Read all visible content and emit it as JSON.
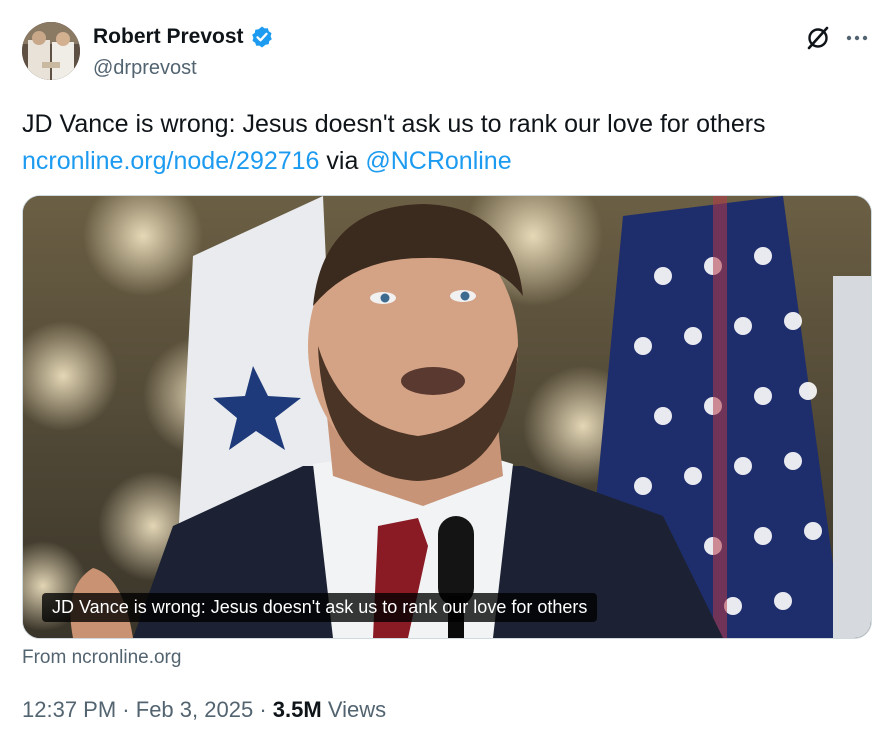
{
  "author": {
    "name": "Robert Prevost",
    "handle": "@drprevost",
    "verified_color": "#1d9bf0"
  },
  "tweet": {
    "text_line": "JD Vance is wrong: Jesus doesn't ask us to rank our love for others",
    "link_text": "ncronline.org/node/292716",
    "via_text": "via",
    "mention_text": "@NCRonline"
  },
  "card": {
    "caption": "JD Vance is wrong: Jesus doesn't ask us to rank our love for others",
    "source": "From ncronline.org"
  },
  "meta": {
    "time": "12:37 PM",
    "dot1": "·",
    "date": "Feb 3, 2025",
    "dot2": "·",
    "views_count": "3.5M",
    "views_label": "Views"
  },
  "icons": {
    "grok": "grok-icon",
    "more": "more-icon",
    "verified": "verified-badge-icon"
  }
}
